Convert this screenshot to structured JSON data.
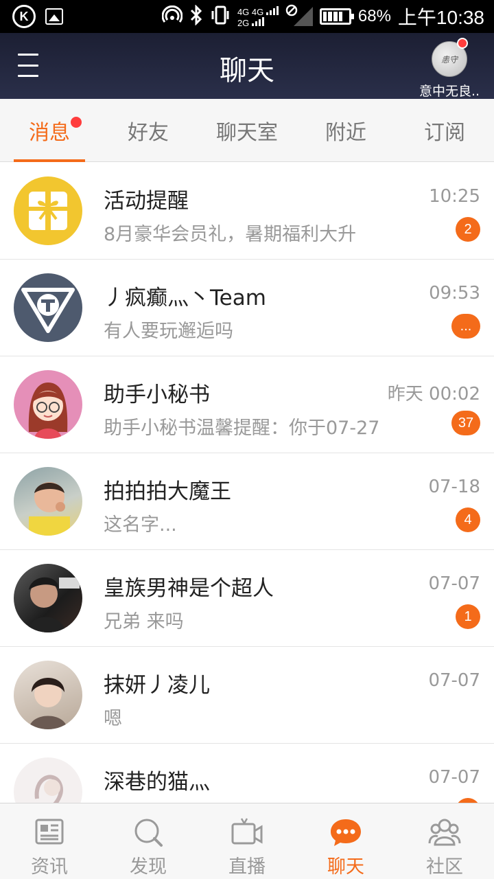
{
  "status_bar": {
    "k_icon": "k-app-icon",
    "image_icon": "image-icon",
    "hotspot_icon": "hotspot-icon",
    "bluetooth_icon": "bluetooth-icon",
    "vibrate_icon": "vibrate-icon",
    "net_top": "4G 4G",
    "net_bottom": "2G",
    "no_sim_icon": "no-sim-icon",
    "battery_level": 0.68,
    "battery": "68%",
    "time": "上午10:38"
  },
  "header": {
    "title": "聊天",
    "menu_icon": "menu-icon",
    "profile_name": "意中无良..",
    "profile_avatar_text": "恚守"
  },
  "tabs": [
    {
      "label": "消息",
      "active": true,
      "dot": true
    },
    {
      "label": "好友",
      "active": false
    },
    {
      "label": "聊天室",
      "active": false
    },
    {
      "label": "附近",
      "active": false
    },
    {
      "label": "订阅",
      "active": false
    }
  ],
  "chats": [
    {
      "name": "活动提醒",
      "time": "10:25",
      "preview": "8月豪华会员礼，暑期福利大升",
      "badge": "2",
      "avatar": "gift-icon"
    },
    {
      "name": "丿疯癫灬丶Team",
      "time": "09:53",
      "preview": "有人要玩邂逅吗",
      "badge": "...",
      "avatar": "team-logo"
    },
    {
      "name": "助手小秘书",
      "time": "昨天 00:02",
      "preview": "助手小秘书温馨提醒：你于07-27",
      "badge": "37",
      "avatar": "assistant-avatar"
    },
    {
      "name": "拍拍拍大魔王",
      "time": "07-18",
      "preview": "这名字...",
      "badge": "4",
      "avatar": "child-photo"
    },
    {
      "name": "皇族男神是个超人",
      "time": "07-07",
      "preview": "兄弟 来吗",
      "badge": "1",
      "avatar": "man-photo"
    },
    {
      "name": "抹妍丿凌儿",
      "time": "07-07",
      "preview": "嗯",
      "badge": "",
      "avatar": "boy-photo"
    },
    {
      "name": "深巷的猫灬",
      "time": "07-07",
      "preview": "",
      "badge": "",
      "avatar": "girl-illustration"
    }
  ],
  "bottom_nav": [
    {
      "label": "资讯",
      "icon": "news-icon",
      "active": false
    },
    {
      "label": "发现",
      "icon": "search-icon",
      "active": false
    },
    {
      "label": "直播",
      "icon": "video-icon",
      "active": false
    },
    {
      "label": "聊天",
      "icon": "chat-icon",
      "active": true
    },
    {
      "label": "社区",
      "icon": "community-icon",
      "active": false
    }
  ],
  "colors": {
    "accent": "#f46b1a",
    "dot": "#ff3d3d",
    "header_bg": "#1c1f33"
  }
}
